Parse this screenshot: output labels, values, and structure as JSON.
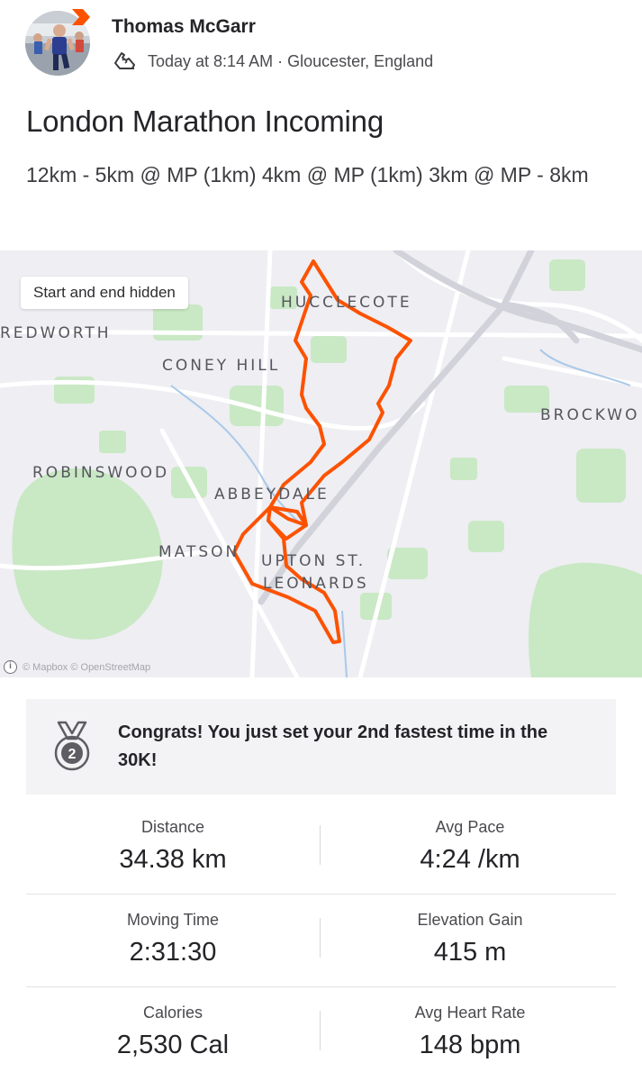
{
  "activity": {
    "athlete_name": "Thomas McGarr",
    "activity_type_icon": "running-shoe-icon",
    "time_location": "Today at 8:14 AM · Gloucester, England",
    "title": "London Marathon Incoming",
    "description": "12km - 5km @ MP (1km) 4km @ MP (1km) 3km @ MP - 8km"
  },
  "map": {
    "privacy_chip": "Start and end hidden",
    "attribution": "© Mapbox © OpenStreetMap",
    "route_color": "#fc5200",
    "labels": {
      "hucclecote": "HUCCLECOTE",
      "redworth": "REDWORTH",
      "coney_hill": "CONEY HILL",
      "brockworth": "BROCKWO",
      "robinswood": "ROBINSWOOD",
      "abbeydale": "ABBEYDALE",
      "matson": "MATSON",
      "upton_line1": "UPTON ST.",
      "upton_line2": "LEONARDS"
    }
  },
  "achievement": {
    "icon": "silver-medal-2-icon",
    "text": "Congrats! You just set your 2nd fastest time in the 30K!"
  },
  "stats": [
    {
      "left": {
        "label": "Distance",
        "value": "34.38 km"
      },
      "right": {
        "label": "Avg Pace",
        "value": "4:24 /km"
      }
    },
    {
      "left": {
        "label": "Moving Time",
        "value": "2:31:30"
      },
      "right": {
        "label": "Elevation Gain",
        "value": "415 m"
      }
    },
    {
      "left": {
        "label": "Calories",
        "value": "2,530 Cal"
      },
      "right": {
        "label": "Avg Heart Rate",
        "value": "148 bpm"
      }
    }
  ],
  "colors": {
    "brand": "#fc5200",
    "text": "#242428",
    "map_green": "#c9e8c4",
    "map_bg": "#eeeef3"
  }
}
